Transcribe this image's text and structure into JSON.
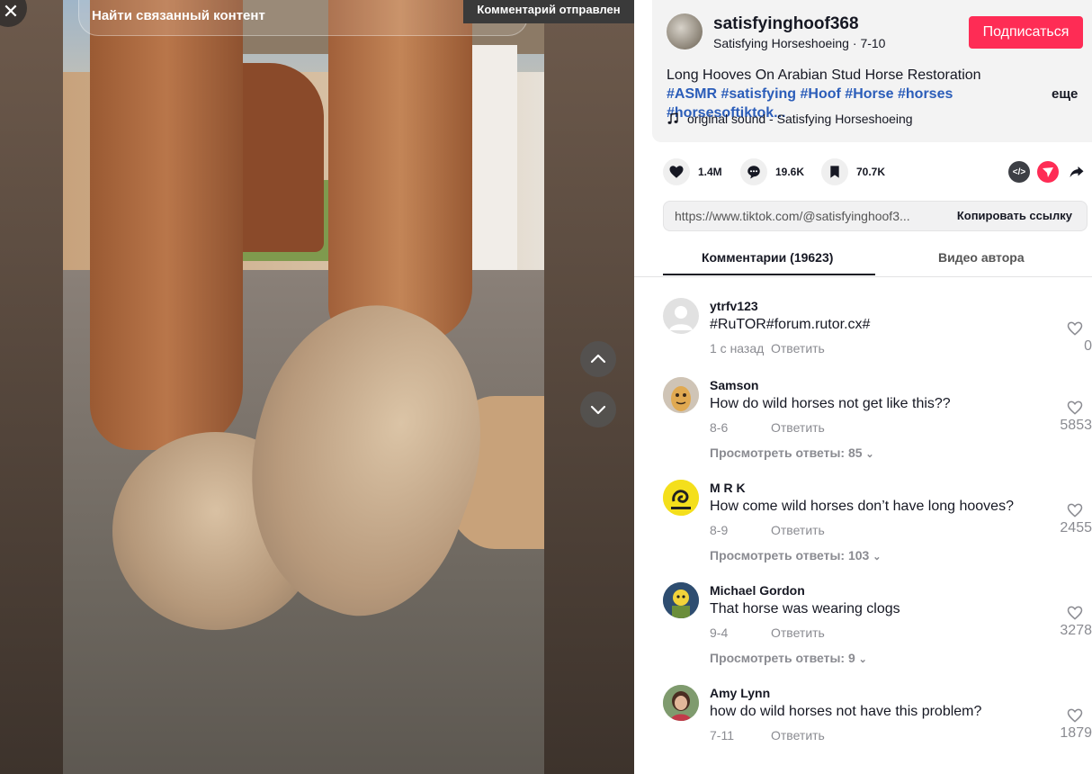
{
  "video": {
    "search_placeholder": "Найти связанный контент",
    "toast": "Комментарий отправлен"
  },
  "author": {
    "username": "satisfyinghoof368",
    "display_name": "Satisfying Horseshoeing",
    "date": "7-10",
    "follow_label": "Подписаться"
  },
  "description": {
    "text": "Long Hooves On Arabian Stud Horse Restoration ",
    "tags": [
      "#ASMR",
      "#satisfying",
      "#Hoof",
      "#Horse",
      "#horses",
      "#horsesoftiktok..."
    ],
    "more_label": "еще",
    "sound": "original sound - Satisfying Horseshoeing"
  },
  "stats": {
    "likes": "1.4M",
    "comments": "19.6K",
    "saves": "70.7K"
  },
  "share": {
    "url": "https://www.tiktok.com/@satisfyinghoof3...",
    "copy_label": "Копировать ссылку"
  },
  "tabs": {
    "comments_label": "Комментарии (19623)",
    "author_videos_label": "Видео автора"
  },
  "reply_label": "Ответить",
  "comments": [
    {
      "user": "ytrfv123",
      "text": "#RuTOR#forum.rutor.cx#",
      "date": "1 с назад",
      "likes": "0",
      "views": ""
    },
    {
      "user": "Samson",
      "text": "How do wild horses not get like this??",
      "date": "8-6",
      "likes": "5853",
      "views": "Просмотреть ответы: 85"
    },
    {
      "user": "M R K",
      "text": "How come wild horses don’t have long hooves?",
      "date": "8-9",
      "likes": "2455",
      "views": "Просмотреть ответы: 103"
    },
    {
      "user": "Michael Gordon",
      "text": "That horse was wearing clogs",
      "date": "9-4",
      "likes": "3278",
      "views": "Просмотреть ответы: 9"
    },
    {
      "user": "Amy Lynn",
      "text": "how do wild horses not have this problem?",
      "date": "7-11",
      "likes": "1879",
      "views": ""
    }
  ],
  "colors": {
    "accent": "#fe2c55",
    "tag": "#2b5db9"
  }
}
